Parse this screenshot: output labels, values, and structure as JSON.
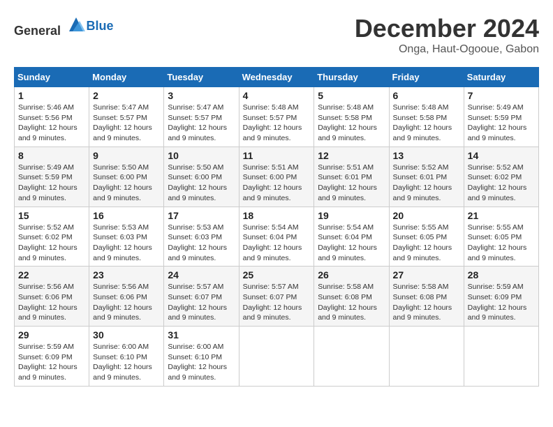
{
  "logo": {
    "general": "General",
    "blue": "Blue"
  },
  "header": {
    "month": "December 2024",
    "location": "Onga, Haut-Ogooue, Gabon"
  },
  "weekdays": [
    "Sunday",
    "Monday",
    "Tuesday",
    "Wednesday",
    "Thursday",
    "Friday",
    "Saturday"
  ],
  "weeks": [
    [
      {
        "day": "1",
        "sunrise": "5:46 AM",
        "sunset": "5:56 PM",
        "daylight": "12 hours and 9 minutes."
      },
      {
        "day": "2",
        "sunrise": "5:47 AM",
        "sunset": "5:57 PM",
        "daylight": "12 hours and 9 minutes."
      },
      {
        "day": "3",
        "sunrise": "5:47 AM",
        "sunset": "5:57 PM",
        "daylight": "12 hours and 9 minutes."
      },
      {
        "day": "4",
        "sunrise": "5:48 AM",
        "sunset": "5:57 PM",
        "daylight": "12 hours and 9 minutes."
      },
      {
        "day": "5",
        "sunrise": "5:48 AM",
        "sunset": "5:58 PM",
        "daylight": "12 hours and 9 minutes."
      },
      {
        "day": "6",
        "sunrise": "5:48 AM",
        "sunset": "5:58 PM",
        "daylight": "12 hours and 9 minutes."
      },
      {
        "day": "7",
        "sunrise": "5:49 AM",
        "sunset": "5:59 PM",
        "daylight": "12 hours and 9 minutes."
      }
    ],
    [
      {
        "day": "8",
        "sunrise": "5:49 AM",
        "sunset": "5:59 PM",
        "daylight": "12 hours and 9 minutes."
      },
      {
        "day": "9",
        "sunrise": "5:50 AM",
        "sunset": "6:00 PM",
        "daylight": "12 hours and 9 minutes."
      },
      {
        "day": "10",
        "sunrise": "5:50 AM",
        "sunset": "6:00 PM",
        "daylight": "12 hours and 9 minutes."
      },
      {
        "day": "11",
        "sunrise": "5:51 AM",
        "sunset": "6:00 PM",
        "daylight": "12 hours and 9 minutes."
      },
      {
        "day": "12",
        "sunrise": "5:51 AM",
        "sunset": "6:01 PM",
        "daylight": "12 hours and 9 minutes."
      },
      {
        "day": "13",
        "sunrise": "5:52 AM",
        "sunset": "6:01 PM",
        "daylight": "12 hours and 9 minutes."
      },
      {
        "day": "14",
        "sunrise": "5:52 AM",
        "sunset": "6:02 PM",
        "daylight": "12 hours and 9 minutes."
      }
    ],
    [
      {
        "day": "15",
        "sunrise": "5:52 AM",
        "sunset": "6:02 PM",
        "daylight": "12 hours and 9 minutes."
      },
      {
        "day": "16",
        "sunrise": "5:53 AM",
        "sunset": "6:03 PM",
        "daylight": "12 hours and 9 minutes."
      },
      {
        "day": "17",
        "sunrise": "5:53 AM",
        "sunset": "6:03 PM",
        "daylight": "12 hours and 9 minutes."
      },
      {
        "day": "18",
        "sunrise": "5:54 AM",
        "sunset": "6:04 PM",
        "daylight": "12 hours and 9 minutes."
      },
      {
        "day": "19",
        "sunrise": "5:54 AM",
        "sunset": "6:04 PM",
        "daylight": "12 hours and 9 minutes."
      },
      {
        "day": "20",
        "sunrise": "5:55 AM",
        "sunset": "6:05 PM",
        "daylight": "12 hours and 9 minutes."
      },
      {
        "day": "21",
        "sunrise": "5:55 AM",
        "sunset": "6:05 PM",
        "daylight": "12 hours and 9 minutes."
      }
    ],
    [
      {
        "day": "22",
        "sunrise": "5:56 AM",
        "sunset": "6:06 PM",
        "daylight": "12 hours and 9 minutes."
      },
      {
        "day": "23",
        "sunrise": "5:56 AM",
        "sunset": "6:06 PM",
        "daylight": "12 hours and 9 minutes."
      },
      {
        "day": "24",
        "sunrise": "5:57 AM",
        "sunset": "6:07 PM",
        "daylight": "12 hours and 9 minutes."
      },
      {
        "day": "25",
        "sunrise": "5:57 AM",
        "sunset": "6:07 PM",
        "daylight": "12 hours and 9 minutes."
      },
      {
        "day": "26",
        "sunrise": "5:58 AM",
        "sunset": "6:08 PM",
        "daylight": "12 hours and 9 minutes."
      },
      {
        "day": "27",
        "sunrise": "5:58 AM",
        "sunset": "6:08 PM",
        "daylight": "12 hours and 9 minutes."
      },
      {
        "day": "28",
        "sunrise": "5:59 AM",
        "sunset": "6:09 PM",
        "daylight": "12 hours and 9 minutes."
      }
    ],
    [
      {
        "day": "29",
        "sunrise": "5:59 AM",
        "sunset": "6:09 PM",
        "daylight": "12 hours and 9 minutes."
      },
      {
        "day": "30",
        "sunrise": "6:00 AM",
        "sunset": "6:10 PM",
        "daylight": "12 hours and 9 minutes."
      },
      {
        "day": "31",
        "sunrise": "6:00 AM",
        "sunset": "6:10 PM",
        "daylight": "12 hours and 9 minutes."
      },
      null,
      null,
      null,
      null
    ]
  ]
}
